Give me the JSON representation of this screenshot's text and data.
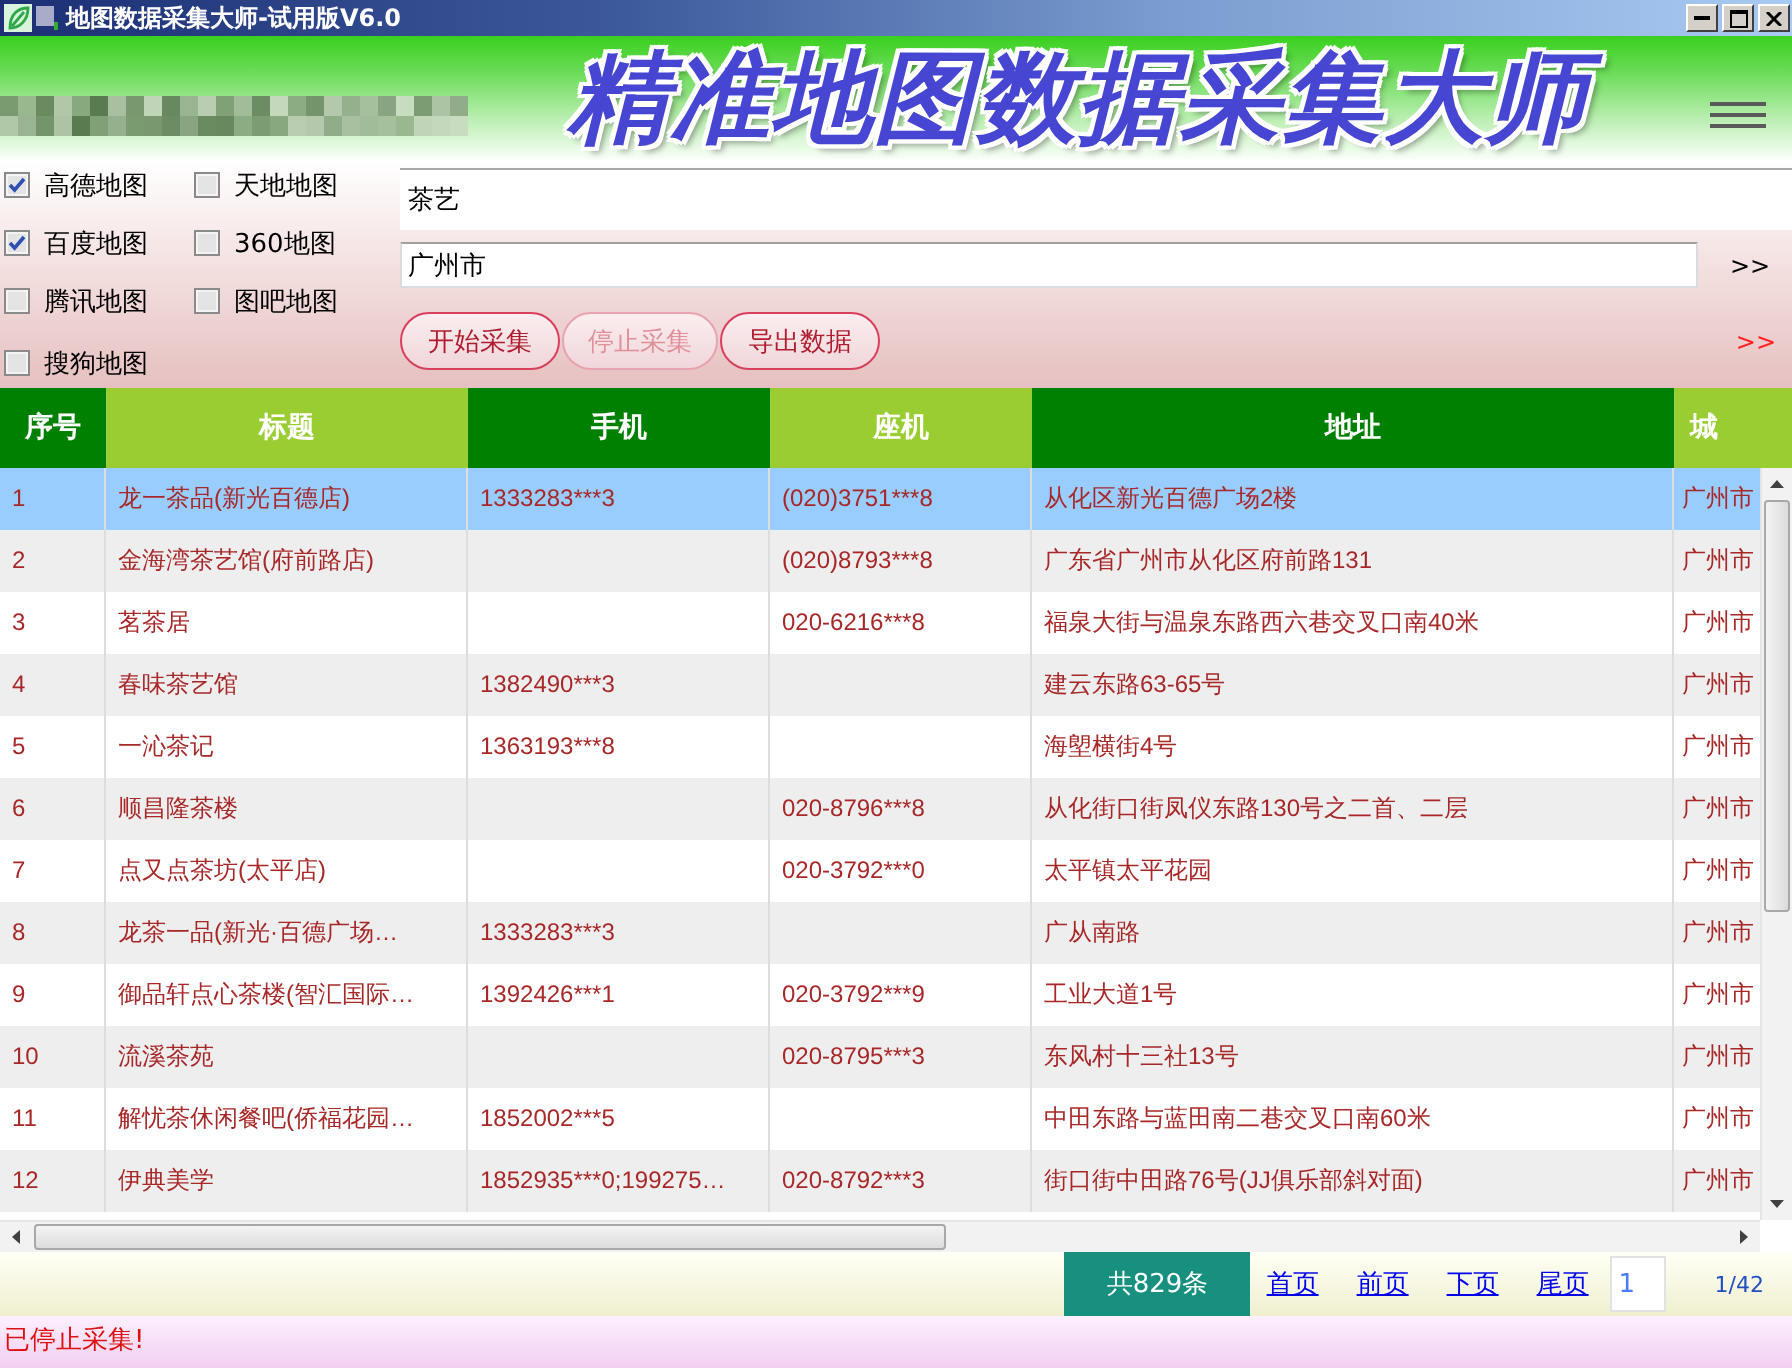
{
  "window": {
    "title": "地图数据采集大师-试用版V6.0"
  },
  "banner": {
    "title": "精准地图数据采集大师"
  },
  "map_sources": [
    {
      "label": "高德地图",
      "checked": true
    },
    {
      "label": "天地地图",
      "checked": false
    },
    {
      "label": "百度地图",
      "checked": true
    },
    {
      "label": "360地图",
      "checked": false
    },
    {
      "label": "腾讯地图",
      "checked": false
    },
    {
      "label": "图吧地图",
      "checked": false
    },
    {
      "label": "搜狗地图",
      "checked": false
    }
  ],
  "keyword_field": {
    "value": "茶艺"
  },
  "city_field": {
    "value": "广州市",
    "expand_button": ">>"
  },
  "buttons": [
    {
      "label": "开始采集",
      "disabled": false
    },
    {
      "label": "停止采集",
      "disabled": true
    },
    {
      "label": "导出数据",
      "disabled": false
    }
  ],
  "more_button": ">>",
  "table": {
    "columns": [
      {
        "label": "序号"
      },
      {
        "label": "标题"
      },
      {
        "label": "手机"
      },
      {
        "label": "座机"
      },
      {
        "label": "地址"
      },
      {
        "label": "城"
      }
    ],
    "rows": [
      {
        "selected": true,
        "number": "1",
        "title": "龙一茶品(新光百德店)",
        "mobile": "1333283***3",
        "landline": "(020)3751***8",
        "address": "从化区新光百德广场2楼",
        "column_6": "广州市"
      },
      {
        "selected": false,
        "number": "2",
        "title": "金海湾茶艺馆(府前路店)",
        "landline": "(020)8793***8",
        "address": "广东省广州市从化区府前路131",
        "column_6": "广州市"
      },
      {
        "selected": false,
        "number": "3",
        "title": "茗茶居",
        "landline": "020-6216***8",
        "address": "福泉大街与温泉东路西六巷交叉口南40米",
        "column_6": "广州市"
      },
      {
        "selected": false,
        "number": "4",
        "title": "春味茶艺馆",
        "mobile": "1382490***3",
        "address": "建云东路63-65号",
        "column_6": "广州市"
      },
      {
        "selected": false,
        "number": "5",
        "title": "一沁茶记",
        "mobile": "1363193***8",
        "address": "海塱横街4号",
        "column_6": "广州市"
      },
      {
        "selected": false,
        "number": "6",
        "title": "顺昌隆茶楼",
        "landline": "020-8796***8",
        "address": "从化街口街凤仪东路130号之二首、二层",
        "column_6": "广州市"
      },
      {
        "selected": false,
        "number": "7",
        "title": "点又点茶坊(太平店)",
        "landline": "020-3792***0",
        "address": "太平镇太平花园",
        "column_6": "广州市"
      },
      {
        "selected": false,
        "number": "8",
        "title": "龙茶一品(新光·百德广场…",
        "mobile": "1333283***3",
        "address": "广从南路",
        "column_6": "广州市"
      },
      {
        "selected": false,
        "number": "9",
        "title": "御品轩点心茶楼(智汇国际…",
        "mobile": "1392426***1",
        "landline": "020-3792***9",
        "address": "工业大道1号",
        "column_6": "广州市"
      },
      {
        "selected": false,
        "number": "10",
        "title": "流溪茶苑",
        "landline": "020-8795***3",
        "address": "东风村十三社13号",
        "column_6": "广州市"
      },
      {
        "selected": false,
        "number": "11",
        "title": "解忧茶休闲餐吧(侨福花园…",
        "mobile": "1852002***5",
        "address": "中田东路与蓝田南二巷交叉口南60米",
        "column_6": "广州市"
      },
      {
        "selected": false,
        "number": "12",
        "title": "伊典美学",
        "mobile": "1852935***0;199275…",
        "landline": "020-8792***3",
        "address": "街口街中田路76号(JJ俱乐部斜对面)",
        "column_6": "广州市"
      }
    ]
  },
  "pagination": {
    "total": "共829条",
    "links": [
      "首页",
      "前页",
      "下页",
      "尾页"
    ],
    "page_field": {
      "value": "1"
    },
    "page_count": "1/42"
  },
  "status_bar": {
    "text": "已停止采集!"
  }
}
